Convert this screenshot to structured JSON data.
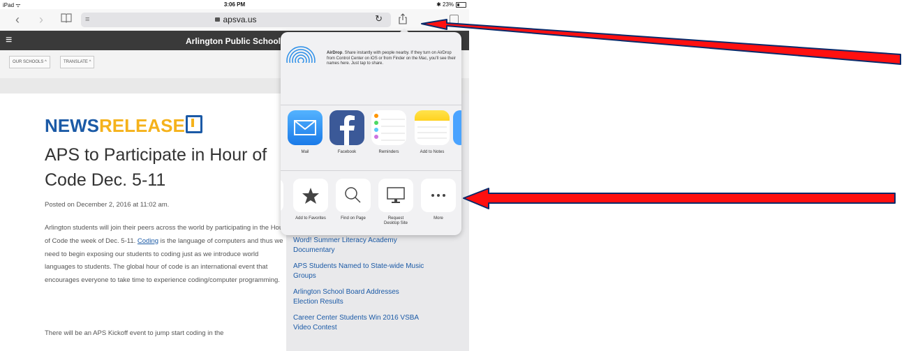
{
  "status_bar": {
    "carrier": "iPad ᯤ",
    "time": "3:06 PM",
    "battery": "✱ 23%"
  },
  "toolbar": {
    "back": "‹",
    "forward": "›",
    "bookmarks": "⌑",
    "reader": "≡",
    "domain": "apsva.us",
    "reload": "↻"
  },
  "site": {
    "title": "Arlington Public Schools",
    "menu_icon": "hamburger-menu-icon"
  },
  "subnav": {
    "our_schools": "OUR SCHOOLS  ^",
    "translate": "TRANSLATE  ^"
  },
  "article": {
    "logo_news": "NEWS",
    "logo_release": "RELEASE",
    "headline": "APS to Participate in Hour of Code Dec. 5-11",
    "posted": "Posted on December 2, 2016 at 11:02 am.",
    "p1_before_link": "Arlington students will join their peers across the world by participating in the Hour of Code the week of Dec. 5-11.",
    "p1_link": "Coding",
    "p1_after_link": " is the language of computers and thus we need to begin exposing our students to coding just as we introduce world languages to students. The global hour of code is an international event that encourages everyone to take time to experience coding/computer programming.",
    "p2": "There will be an APS Kickoff event to jump start coding in the"
  },
  "sidebar": {
    "news": [
      "Word! Summer Literacy Academy Documentary",
      "APS Students Named to State-wide Music Groups",
      "Arlington School Board Addresses Election Results",
      "Career Center Students Win 2016 VSBA Video Contest"
    ]
  },
  "share_sheet": {
    "airdrop_title": "AirDrop",
    "airdrop_text": ". Share instantly with people nearby. If they turn on AirDrop from Control Center on iOS or from Finder on the Mac, you'll see their names here. Just tap to share.",
    "apps": [
      {
        "label": "Mail",
        "icon": "mail-icon",
        "color": "#2d8cf0"
      },
      {
        "label": "Facebook",
        "icon": "facebook-icon",
        "color": "#3b5998"
      },
      {
        "label": "Reminders",
        "icon": "reminders-icon",
        "color": "#ffffff"
      },
      {
        "label": "Add to Notes",
        "icon": "notes-icon",
        "color": "#ffe06b"
      }
    ],
    "actions": [
      {
        "label": "Add to Favorites",
        "icon": "star-icon"
      },
      {
        "label": "Find on Page",
        "icon": "magnifier-icon"
      },
      {
        "label": "Request\nDesktop Site",
        "icon": "desktop-icon"
      },
      {
        "label": "More",
        "icon": "more-icon"
      }
    ]
  },
  "annotations": {
    "arrow_color": "#e00000"
  }
}
